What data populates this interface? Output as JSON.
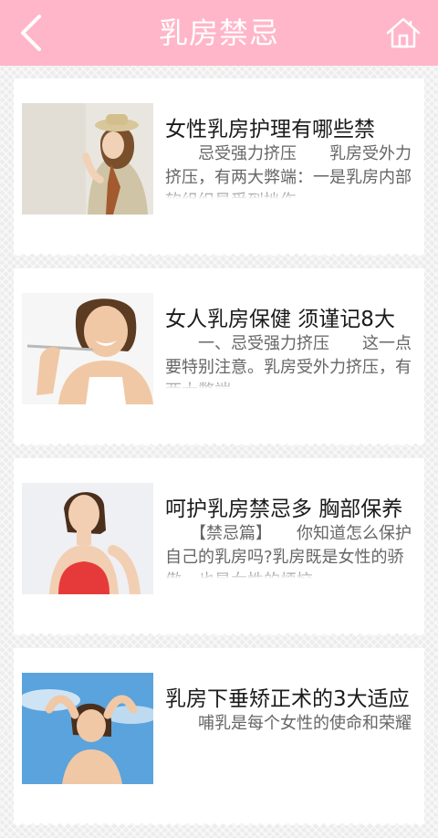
{
  "header": {
    "title": "乳房禁忌",
    "back_icon": "chevron-left-icon",
    "home_icon": "home-icon"
  },
  "colors": {
    "header_bg": "#ffb6c8",
    "card_bg": "#ffffff",
    "title_text": "#1b1b1b",
    "summary_text": "#666666"
  },
  "articles": [
    {
      "title": "女性乳房护理有哪些禁",
      "summary": "　　忌受强力挤压　　乳房受外力挤压，有两大弊端：一是乳房内部软组织易受到挫伤"
    },
    {
      "title": "女人乳房保健 须谨记8大",
      "summary": "　　一、忌受强力挤压　　这一点要特别注意。乳房受外力挤压，有两大弊端"
    },
    {
      "title": "呵护乳房禁忌多 胸部保养",
      "summary": "　　【禁忌篇】　　你知道怎么保护自己的乳房吗?乳房既是女性的骄傲，也是女性的烦恼"
    },
    {
      "title": "乳房下垂矫正术的3大适应",
      "summary": "　　哺乳是每个女性的使命和荣耀"
    }
  ]
}
